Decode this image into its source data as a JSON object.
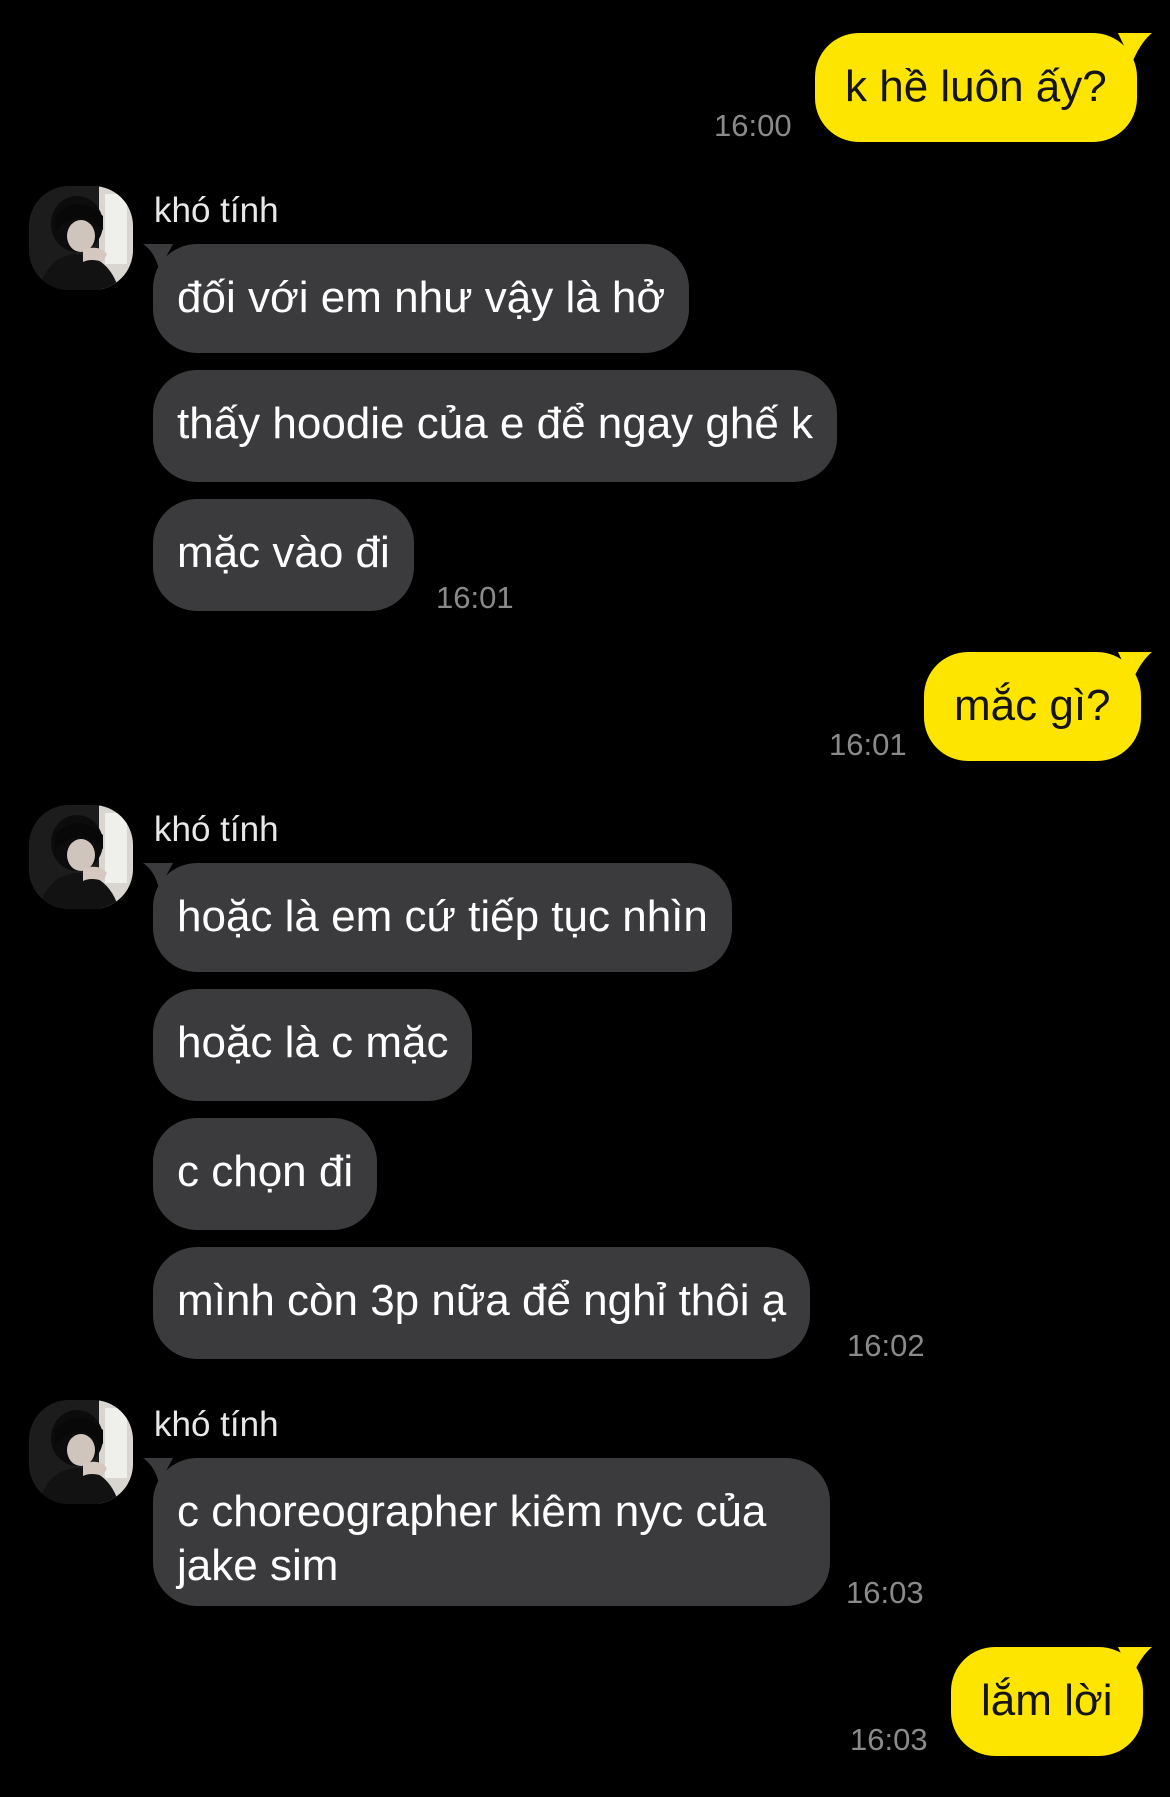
{
  "contact": {
    "name": "khó tính"
  },
  "colors": {
    "background": "#000000",
    "incoming_bubble": "#3b3b3d",
    "outgoing_bubble": "#fee500",
    "timestamp": "#8a8a8a"
  },
  "messages": {
    "m1": {
      "text": "k hề luôn ấy?",
      "time": "16:00",
      "sender": "me"
    },
    "g1": {
      "sender_name": "khó tính",
      "bubbles": [
        "đối với em như vậy là hở",
        "thấy hoodie của e để ngay ghế k",
        "mặc vào đi"
      ],
      "time": "16:01"
    },
    "m2": {
      "text": "mắc gì?",
      "time": "16:01",
      "sender": "me"
    },
    "g2": {
      "sender_name": "khó tính",
      "bubbles": [
        "hoặc là em cứ tiếp tục nhìn",
        "hoặc là c mặc",
        "c chọn đi",
        "mình còn 3p nữa để nghỉ thôi ạ"
      ],
      "time": "16:02"
    },
    "g3": {
      "sender_name": "khó tính",
      "bubbles": [
        "c choreographer kiêm nyc của jake sim"
      ],
      "time": "16:03"
    },
    "m3": {
      "text": "lắm lời",
      "time": "16:03",
      "sender": "me"
    }
  },
  "icons": {
    "avatar": "profile-photo-avatar-icon"
  }
}
